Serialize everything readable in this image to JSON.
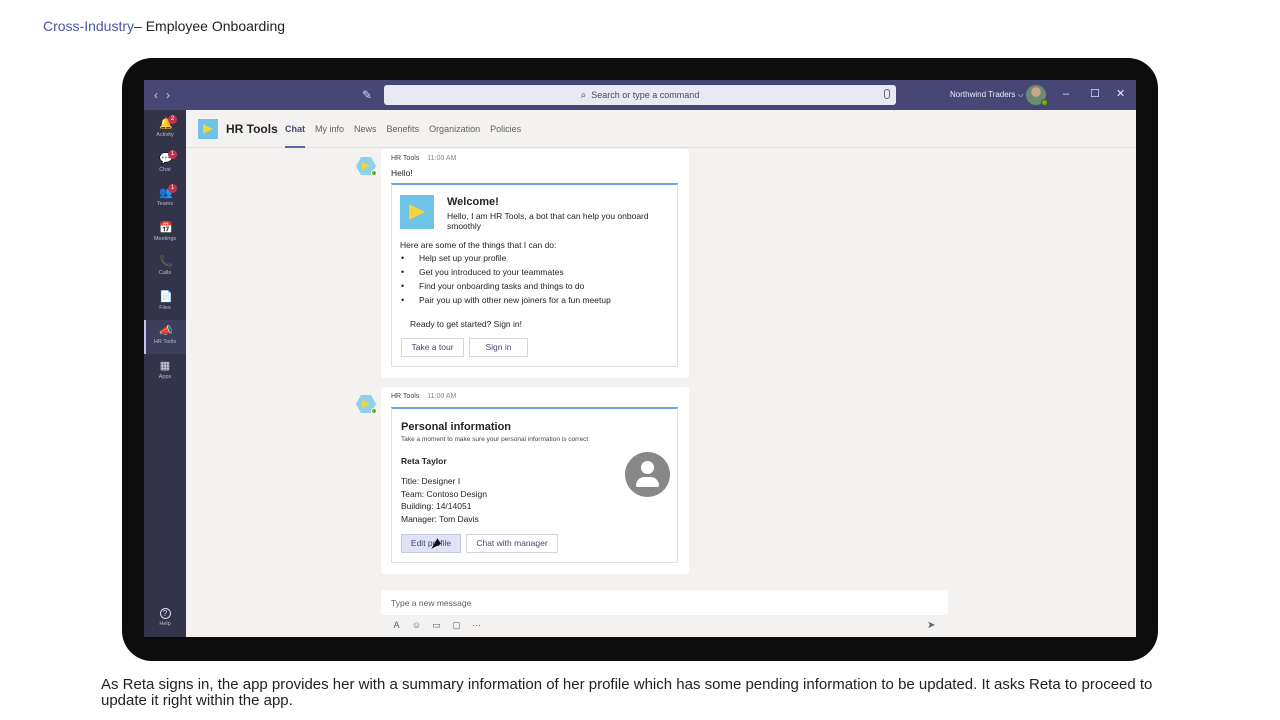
{
  "slide": {
    "breadcrumb": "Cross-Industry",
    "title": "– Employee Onboarding",
    "caption": "As Reta signs in, the app provides her with a summary information of her profile which has some pending information to be updated. It asks Reta to proceed to update it right within the app."
  },
  "titlebar": {
    "search_placeholder": "Search or type a command",
    "org": "Northwind Traders ⌵",
    "back": "‹",
    "forward": "›",
    "minimize": "–",
    "maximize": "☐",
    "close": "✕"
  },
  "rail": {
    "items": [
      {
        "label": "Activity",
        "icon": "bell-icon",
        "glyph": "🔔",
        "badge": "2"
      },
      {
        "label": "Chat",
        "icon": "chat-icon",
        "glyph": "💬",
        "badge": "1"
      },
      {
        "label": "Teams",
        "icon": "teams-icon",
        "glyph": "👥",
        "badge": "1"
      },
      {
        "label": "Meetings",
        "icon": "calendar-icon",
        "glyph": "📅"
      },
      {
        "label": "Calls",
        "icon": "phone-icon",
        "glyph": "📞"
      },
      {
        "label": "Files",
        "icon": "file-icon",
        "glyph": "📄"
      },
      {
        "label": "HR Tools",
        "icon": "megaphone-icon",
        "glyph": "📣"
      },
      {
        "label": "Apps",
        "icon": "apps-icon",
        "glyph": "▦"
      }
    ],
    "help": {
      "label": "Help",
      "icon": "help-icon",
      "glyph": "?"
    }
  },
  "app": {
    "name": "HR Tools",
    "tabs": [
      "Chat",
      "My info",
      "News",
      "Benefits",
      "Organization",
      "Policies"
    ],
    "active_tab": "Chat"
  },
  "messages": [
    {
      "sender": "HR Tools",
      "time": "11:00 AM",
      "text": "Hello!",
      "card": {
        "title": "Welcome!",
        "intro": "Hello, I am HR Tools, a bot that can help you onboard smoothly",
        "lead": "Here are some of the things that I can do:",
        "bullets": [
          "Help set up your profile",
          "Get you introduced to your teammates",
          "Find your onboarding tasks and things to do",
          "Pair you up with other new joiners for a fun meetup"
        ],
        "cta": "Ready to get started? Sign in!",
        "buttons": [
          "Take a tour",
          "Sign in"
        ]
      }
    },
    {
      "sender": "HR Tools",
      "time": "11:00 AM",
      "card": {
        "title": "Personal information",
        "subtitle": "Take a moment to make sure your personal information is correct",
        "name": "Reta Taylor",
        "fields": [
          "Title: Designer I",
          "Team: Contoso Design",
          "Building: 14/14051",
          "Manager: Tom Davis"
        ],
        "buttons": [
          "Edit profile",
          "Chat with manager"
        ]
      }
    }
  ],
  "compose": {
    "placeholder": "Type a new message",
    "tools": [
      {
        "icon": "format-icon",
        "glyph": "A"
      },
      {
        "icon": "emoji-icon",
        "glyph": "☺"
      },
      {
        "icon": "gif-icon",
        "glyph": "▭"
      },
      {
        "icon": "sticker-icon",
        "glyph": "▢"
      },
      {
        "icon": "more-icon",
        "glyph": "···"
      }
    ],
    "send_glyph": "➤"
  },
  "colors": {
    "titlebar": "#464775",
    "rail": "#33344a",
    "accent": "#6264a7",
    "card_border": "#6f9fd8"
  }
}
